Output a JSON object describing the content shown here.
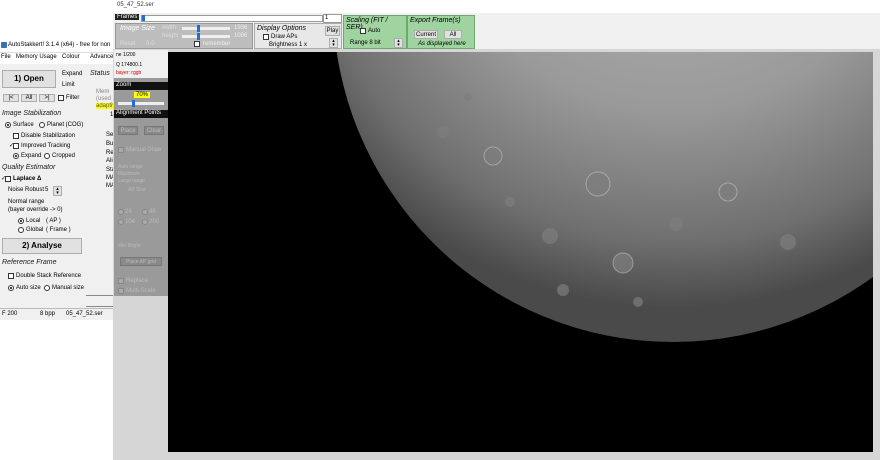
{
  "main_window": {
    "title": "AutoStakkert! 3.1.4 (x64) - free for non",
    "menu": [
      "File",
      "Memory Usage",
      "Colour",
      "Advance"
    ],
    "open_button": "1) Open",
    "expand_label": "Expand",
    "limit_label": "Limit",
    "nav_buttons": [
      "|<",
      "All",
      ">|"
    ],
    "filter_label": "Filter",
    "status_label": "Status",
    "image_stabilization": {
      "heading": "Image Stabilization",
      "surface_label": "Surface",
      "planet_label": "Planet (COG)",
      "disable_label": "Disable Stabilization",
      "improved_label": "Improved Tracking",
      "expand_label": "Expand",
      "cropped_label": "Cropped"
    },
    "quality_estimator": {
      "heading": "Quality Estimator",
      "laplace_label": "Laplace Δ",
      "noise_robust_label": "Noise Robust",
      "noise_robust_value": "5",
      "normal_range_label": "Normal range",
      "bayer_override_label": "(bayer override -> 0)",
      "local_label": "Local",
      "local_suffix": "( AP )",
      "global_label": "Global",
      "global_suffix": "( Frame )"
    },
    "analyse_button": "2) Analyse",
    "reference_frame": {
      "heading": "Reference Frame",
      "double_stack_label": "Double Stack Reference",
      "auto_size_label": "Auto size",
      "manual_size_label": "Manual size"
    },
    "status_bar": [
      "F 200",
      "8 bpp",
      "05_47_52.ser"
    ],
    "status_side_text": [
      "Mem",
      "(used D)",
      "adaptive",
      "1"
    ],
    "status_side_letters": [
      "Ser",
      "Bui",
      "Ref",
      "Alig",
      "Sta",
      "MA",
      "MA"
    ]
  },
  "image_window": {
    "title": "05_47_52.ser",
    "frames_label": "Frames",
    "frame_value": "1",
    "image_size": {
      "heading": "Image Size",
      "width_label": "width",
      "height_label": "height",
      "width_value": "1936",
      "height_value": "1096",
      "reset_label": "Reset",
      "reset_value": "0-0",
      "remember_label": "remember"
    },
    "display_options": {
      "heading": "Display Options",
      "draw_aps_label": "Draw APs",
      "brightness_label": "Brightness 1 x",
      "play_button": "Play"
    },
    "scaling": {
      "heading": "Scaling (FIT / SER)",
      "auto_label": "Auto",
      "range_label": "Range 8 bit"
    },
    "export": {
      "heading": "Export Frame(s)",
      "current_button": "Current",
      "all_button": "All",
      "as_displayed_label": "As displayed here"
    },
    "side_panel": {
      "frame_counter": "ne 1/200",
      "q_value": "Q  174800.1",
      "bayer_label": "bayer: rggb",
      "zoom_heading": "Zoom",
      "zoom_value": "70%",
      "ap_heading": "Alignment Points",
      "clear_button": "Clear",
      "place_button": "Place",
      "manual_draw_label": "Manual Draw",
      "ap_size_label": "AP Size",
      "ap_grid_text": [
        "Auto range",
        "Maximum",
        "Large range"
      ],
      "sizes": [
        "24",
        "48",
        "104",
        "200"
      ],
      "min_bright_label": "Min Bright",
      "place_grid_button": "Place AP grid",
      "replace_label": "Replace",
      "multi_scale_label": "Multi-Scale"
    }
  },
  "colors": {
    "green_panel": "#9fd39f",
    "zoom_highlight": "#ffff00",
    "panel_gray": "#9a9a9a",
    "window_bg": "#f0f0f0"
  }
}
